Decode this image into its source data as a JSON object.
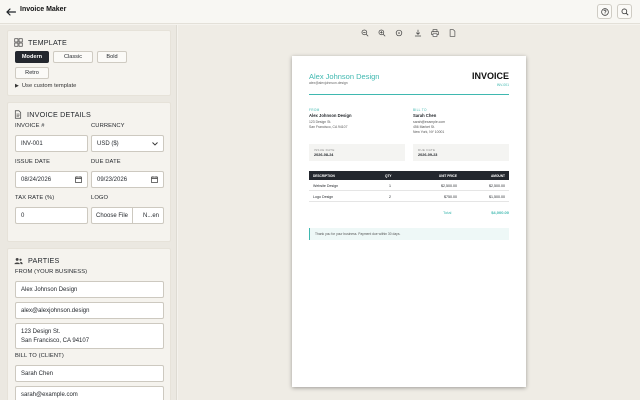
{
  "app": {
    "title": "Invoice Maker"
  },
  "colors": {
    "accent": "#3fb8b0",
    "dark": "#23272e",
    "sidebar_bg": "#ebe8e1"
  },
  "template": {
    "heading": "TEMPLATE",
    "options": [
      "Modern",
      "Classic",
      "Bold",
      "Retro"
    ],
    "selected": "Modern",
    "custom_link": "Use custom template"
  },
  "details": {
    "heading": "INVOICE DETAILS",
    "invoice_no_label": "INVOICE #",
    "invoice_no": "INV-001",
    "currency_label": "CURRENCY",
    "currency": "USD ($)",
    "issue_date_label": "ISSUE DATE",
    "issue_date": "08/24/2026",
    "due_date_label": "DUE DATE",
    "due_date": "09/23/2026",
    "tax_label": "TAX RATE (%)",
    "tax": "0",
    "logo_label": "LOGO",
    "choose_file": "Choose File",
    "no_file": "N...en"
  },
  "parties": {
    "heading": "PARTIES",
    "from_label": "FROM (YOUR BUSINESS)",
    "from_name": "Alex Johnson Design",
    "from_email": "alex@alexjohnson.design",
    "from_address": "123 Design St.\nSan Francisco, CA 94107",
    "to_label": "BILL TO (CLIENT)",
    "to_name": "Sarah Chen",
    "to_email": "sarah@example.com"
  },
  "invoice": {
    "business_name": "Alex Johnson Design",
    "business_email": "alex@alexjohnson.design",
    "title": "INVOICE",
    "number": "INV-001",
    "from_label": "FROM",
    "from_name": "Alex Johnson Design",
    "from_line1": "123 Design St.",
    "from_line2": "San Francisco, CA 94107",
    "billto_label": "BILL TO",
    "to_name": "Sarah Chen",
    "to_email": "sarah@example.com",
    "to_line1": "456 Market St.",
    "to_line2": "New York, NY 10001",
    "issue_label": "ISSUE DATE",
    "issue_value": "2026-08-24",
    "due_label": "DUE DATE",
    "due_value": "2026-09-23",
    "columns": [
      "DESCRIPTION",
      "QTY",
      "UNIT PRICE",
      "AMOUNT"
    ],
    "rows": [
      [
        "Website Design",
        "1",
        "$2,500.00",
        "$2,500.00"
      ],
      [
        "Logo Design",
        "2",
        "$750.00",
        "$1,500.00"
      ]
    ],
    "total_label": "Total",
    "total_value": "$4,000.00",
    "note": "Thank you for your business. Payment due within 30 days."
  }
}
